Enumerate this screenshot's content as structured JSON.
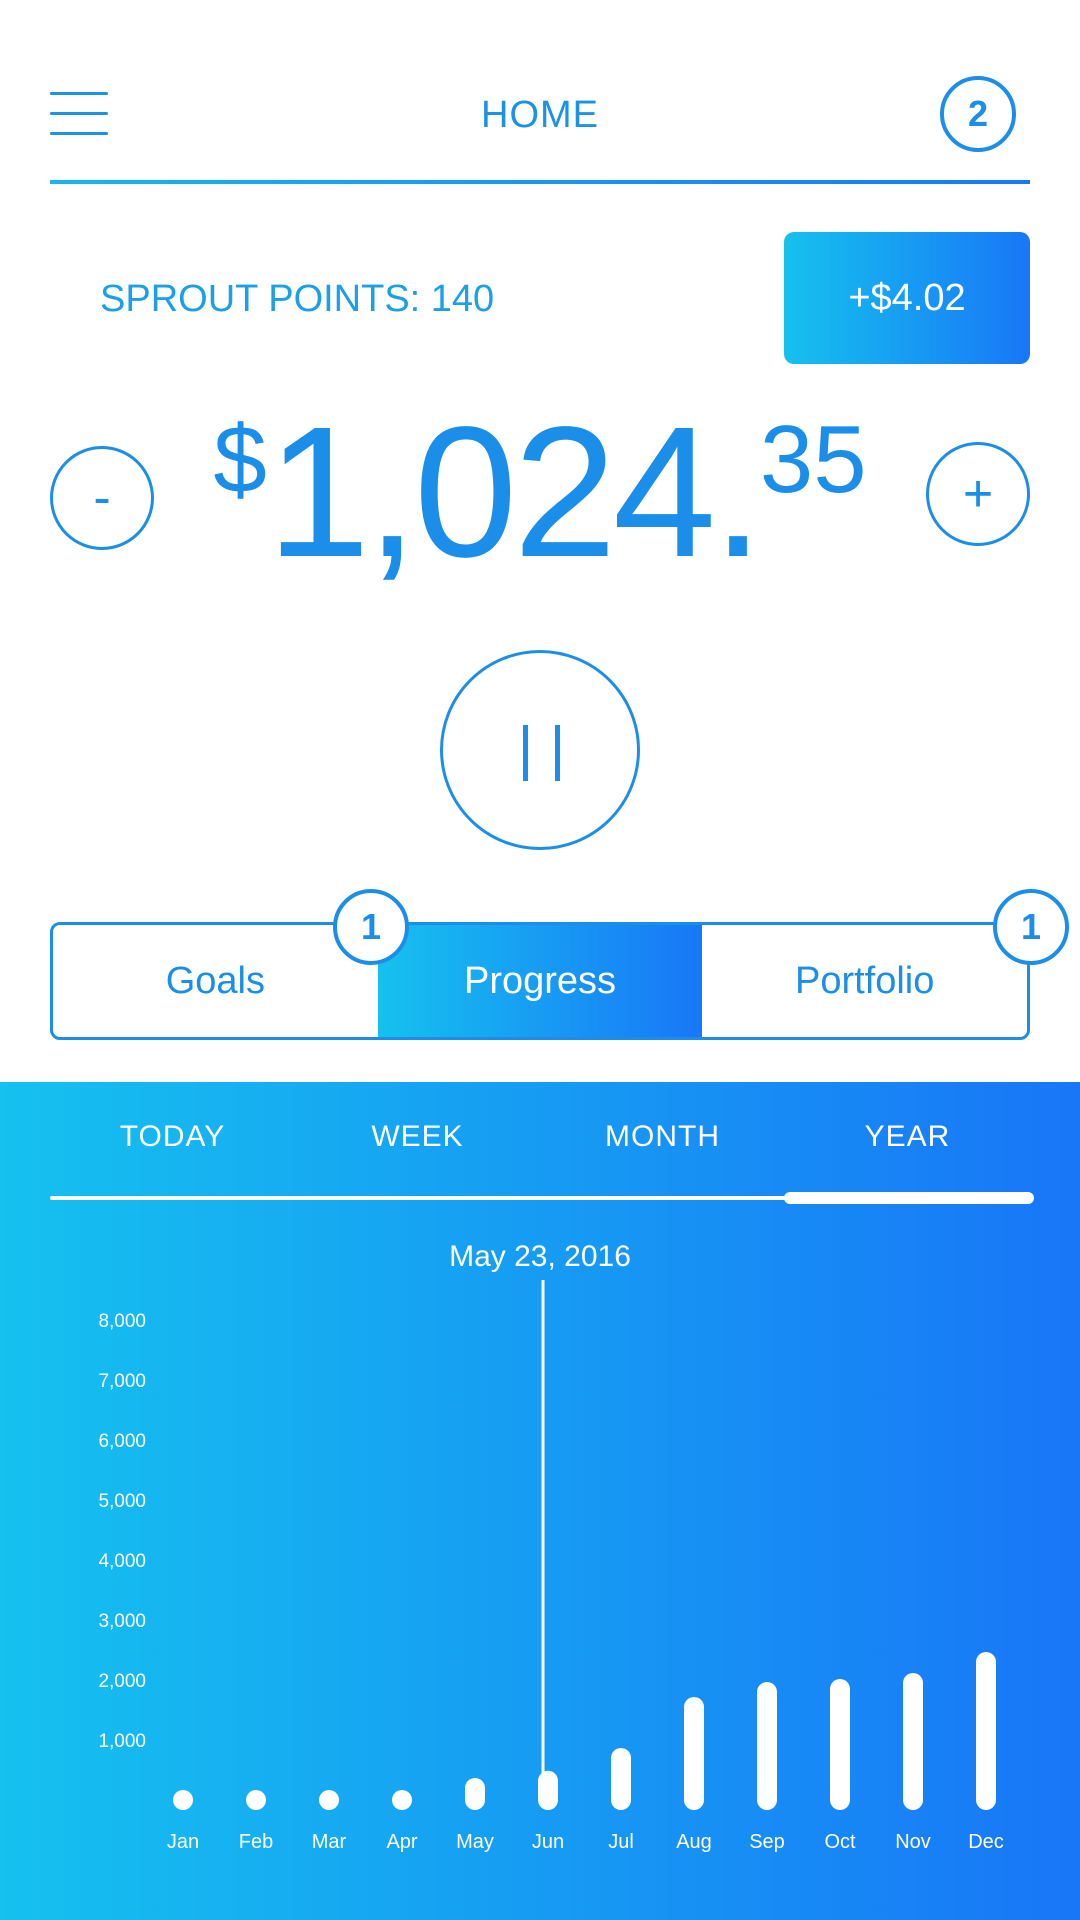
{
  "header": {
    "title": "HOME",
    "notifications": "2"
  },
  "sprout": {
    "label": "SPROUT POINTS: 140",
    "gain": "+$4.02"
  },
  "balance": {
    "currency": "$",
    "whole": "1,024.",
    "cents": "35"
  },
  "controls": {
    "minus": "-",
    "plus": "+"
  },
  "tabs": [
    {
      "label": "Goals",
      "badge": "1",
      "active": false
    },
    {
      "label": "Progress",
      "active": true
    },
    {
      "label": "Portfolio",
      "badge": "1",
      "active": false
    }
  ],
  "range": {
    "options": [
      "TODAY",
      "WEEK",
      "MONTH",
      "YEAR"
    ],
    "selected": "YEAR"
  },
  "chart_date": "May 23, 2016",
  "colors": {
    "accent": "#1a8ee8",
    "gradient_start": "#15c1ef",
    "gradient_end": "#1876f7"
  },
  "icons": {
    "menu": "hamburger-icon",
    "pause": "pause-icon"
  },
  "chart_data": {
    "type": "bar",
    "categories": [
      "Jan",
      "Feb",
      "Mar",
      "Apr",
      "May",
      "Jun",
      "Jul",
      "Aug",
      "Sep",
      "Oct",
      "Nov",
      "Dec"
    ],
    "values": [
      0,
      0,
      0,
      0,
      200,
      320,
      700,
      1550,
      1800,
      1850,
      1950,
      2300
    ],
    "yticks": [
      "1,000",
      "2,000",
      "3,000",
      "4,000",
      "5,000",
      "6,000",
      "7,000",
      "8,000"
    ],
    "ylim": [
      0,
      8000
    ],
    "marker": "Jun",
    "grid": false
  }
}
